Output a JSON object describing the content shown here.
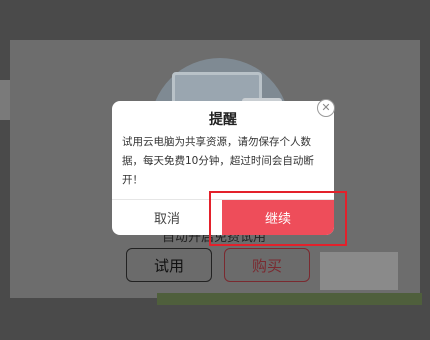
{
  "background": {
    "subtitle": "自动开启免费试用",
    "trial_button": "试用",
    "buy_button": "购买"
  },
  "dialog": {
    "title": "提醒",
    "message": "试用云电脑为共享资源，请勿保存个人数据，每天免费10分钟，超过时间会自动断开！",
    "cancel_label": "取消",
    "confirm_label": "继续",
    "close_icon": "close-icon"
  },
  "colors": {
    "confirm_bg": "#ee4d5a",
    "highlight": "#e3212b"
  }
}
